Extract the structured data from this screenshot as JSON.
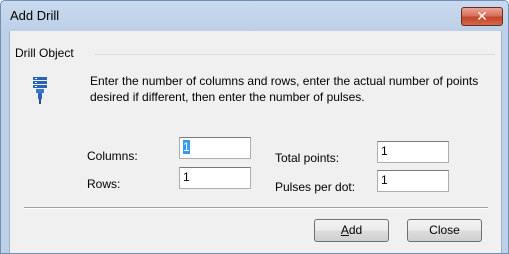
{
  "window": {
    "title": "Add Drill",
    "close_glyph": "✕"
  },
  "group": {
    "label": "Drill Object",
    "icon": "drill-icon"
  },
  "instructions": "Enter the number of columns and rows, enter the actual number of points desired if different, then enter the number of pulses.",
  "fields": {
    "columns": {
      "label": "Columns:",
      "value": "1"
    },
    "rows": {
      "label": "Rows:",
      "value": "1"
    },
    "total_points": {
      "label": "Total points:",
      "value": "1"
    },
    "pulses_per_dot": {
      "label": "Pulses per dot:",
      "value": "1"
    }
  },
  "buttons": {
    "add_mnemonic": "A",
    "add_rest": "dd",
    "close": "Close"
  },
  "colors": {
    "selection": "#3399ff",
    "icon": "#2a62b8"
  }
}
